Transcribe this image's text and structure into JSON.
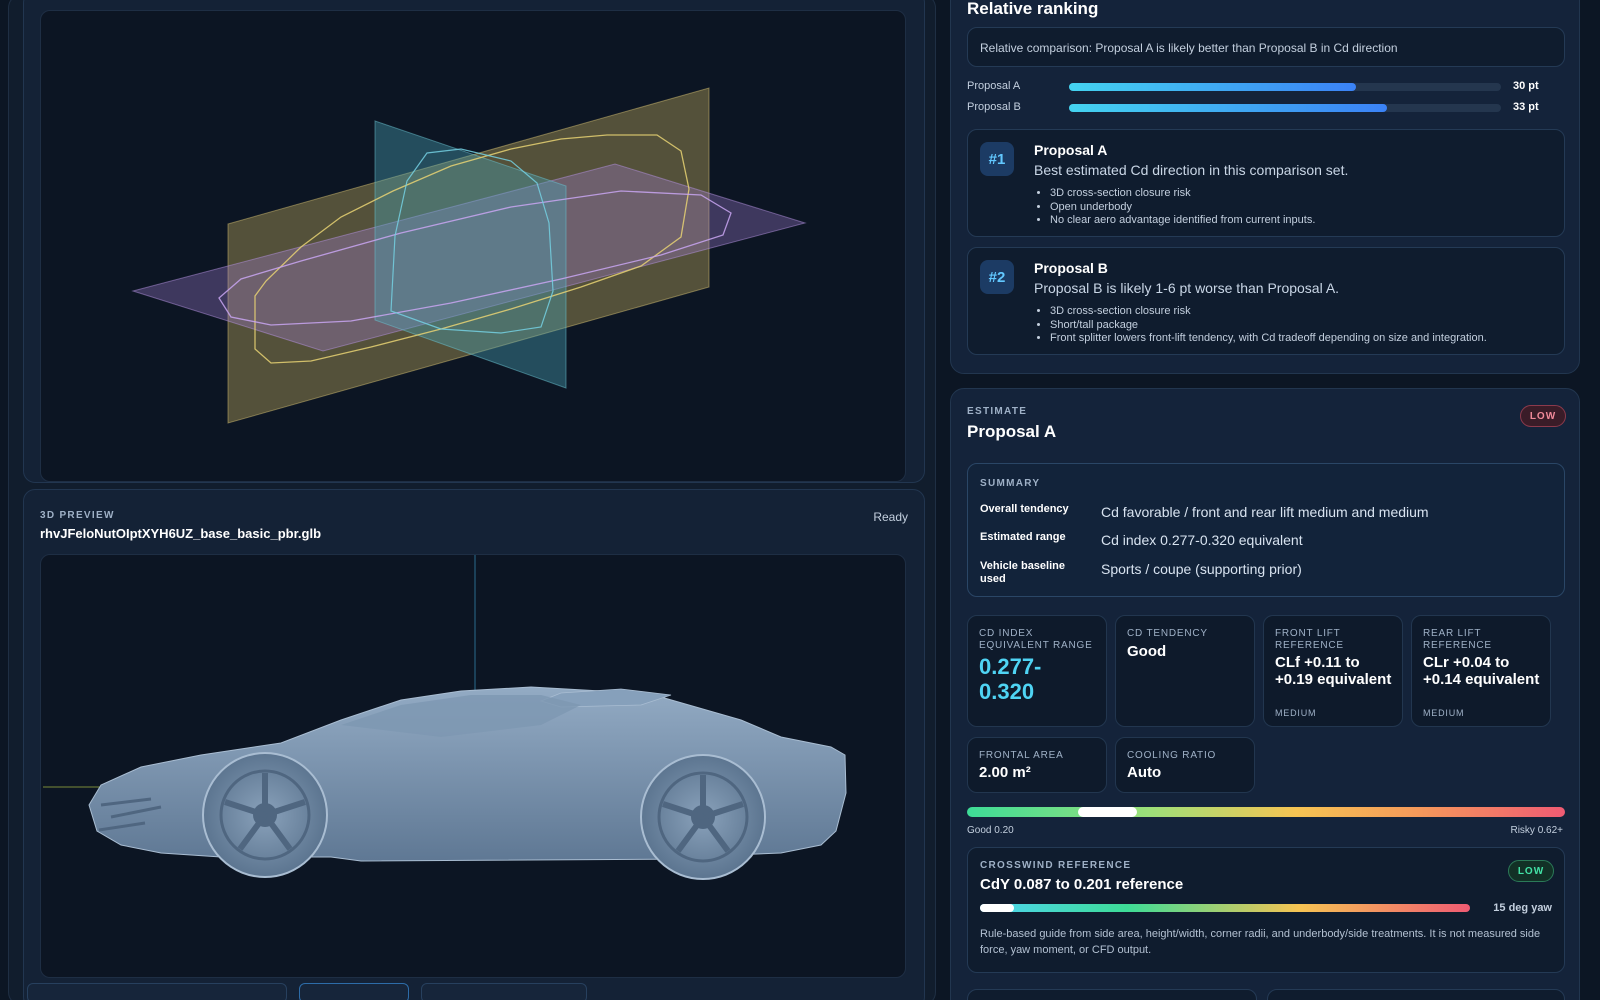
{
  "colors": {
    "accent": "#4fd4f4",
    "background": "#0c1624",
    "badge_low_red": "#f08a9a",
    "badge_low_green": "#43e3a6"
  },
  "preview": {
    "eyebrow": "3D PREVIEW",
    "filename": "rhvJFeloNutOIptXYH6UZ_base_basic_pbr.glb",
    "status": "Ready"
  },
  "ranking": {
    "title": "Relative ranking",
    "comparison_note": "Relative comparison: Proposal A is likely better than Proposal B in Cd direction",
    "bars": [
      {
        "label": "Proposal A",
        "value_label": "30 pt",
        "fill": 0.665
      },
      {
        "label": "Proposal B",
        "value_label": "33 pt",
        "fill": 0.735
      }
    ],
    "proposals": [
      {
        "rank": "#1",
        "name": "Proposal A",
        "summary": "Best estimated Cd direction in this comparison set.",
        "notes": [
          "3D cross-section closure risk",
          "Open underbody",
          "No clear aero advantage identified from current inputs."
        ]
      },
      {
        "rank": "#2",
        "name": "Proposal B",
        "summary": "Proposal B is likely 1-6 pt worse than Proposal A.",
        "notes": [
          "3D cross-section closure risk",
          "Short/tall package",
          "Front splitter lowers front-lift tendency, with Cd tradeoff depending on size and integration."
        ]
      }
    ]
  },
  "estimate": {
    "eyebrow": "ESTIMATE",
    "title": "Proposal A",
    "confidence_badge": "LOW",
    "summary": {
      "eyebrow": "SUMMARY",
      "rows": [
        {
          "label": "Overall tendency",
          "value": "Cd favorable / front and rear lift medium and medium"
        },
        {
          "label": "Estimated range",
          "value": "Cd index 0.277-0.320 equivalent"
        },
        {
          "label": "Vehicle baseline used",
          "value": "Sports / coupe (supporting prior)"
        }
      ]
    },
    "metrics": [
      {
        "label": "CD INDEX EQUIVALENT RANGE",
        "value": "0.277-0.320",
        "sub": ""
      },
      {
        "label": "CD TENDENCY",
        "value": "Good",
        "sub": ""
      },
      {
        "label": "FRONT LIFT REFERENCE",
        "value": "CLf +0.11 to +0.19 equivalent",
        "sub": "MEDIUM"
      },
      {
        "label": "REAR LIFT REFERENCE",
        "value": "CLr +0.04 to +0.14 equivalent",
        "sub": "MEDIUM"
      },
      {
        "label": "FRONTAL AREA",
        "value": "2.00 m²",
        "sub": ""
      },
      {
        "label": "COOLING RATIO",
        "value": "Auto",
        "sub": ""
      }
    ],
    "scale": {
      "min_label": "Good 0.20",
      "max_label": "Risky 0.62+",
      "marker_start": 0.185,
      "marker_end": 0.285
    },
    "crosswind": {
      "eyebrow": "CROSSWIND REFERENCE",
      "value": "CdY 0.087 to 0.201 reference",
      "badge": "LOW",
      "yaw_label": "15 deg yaw",
      "marker_start": 0.0,
      "marker_end": 0.07,
      "note": "Rule-based guide from side area, height/width, corner radii, and underbody/side treatments. It is not measured side force, yaw moment, or CFD output."
    }
  }
}
